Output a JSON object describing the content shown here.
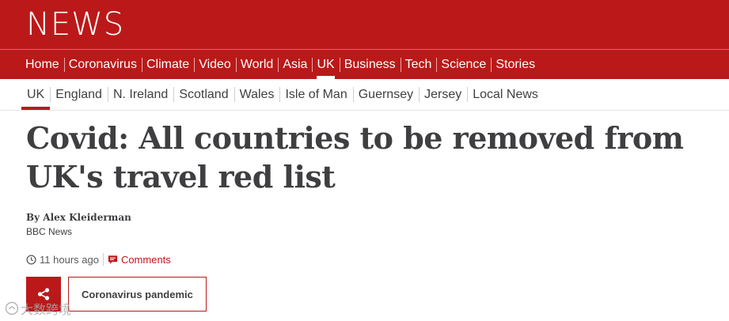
{
  "brand": {
    "logo": "NEWS",
    "color": "#bb1919"
  },
  "main_nav": {
    "items": [
      "Home",
      "Coronavirus",
      "Climate",
      "Video",
      "World",
      "Asia",
      "UK",
      "Business",
      "Tech",
      "Science",
      "Stories"
    ],
    "active": "UK"
  },
  "sub_nav": {
    "items": [
      "UK",
      "England",
      "N. Ireland",
      "Scotland",
      "Wales",
      "Isle of Man",
      "Guernsey",
      "Jersey",
      "Local News"
    ],
    "active": "UK"
  },
  "article": {
    "headline": "Covid: All countries to be removed from UK's travel red list",
    "author": "By Alex Kleiderman",
    "organization": "BBC News",
    "timestamp": "11 hours ago",
    "comments_label": "Comments",
    "topic_tag": "Coronavirus pandemic",
    "timestamp_icon": "clock-icon",
    "comments_icon": "comment-icon",
    "share_icon": "share-icon"
  },
  "watermark": {
    "text": "大数跨境"
  }
}
